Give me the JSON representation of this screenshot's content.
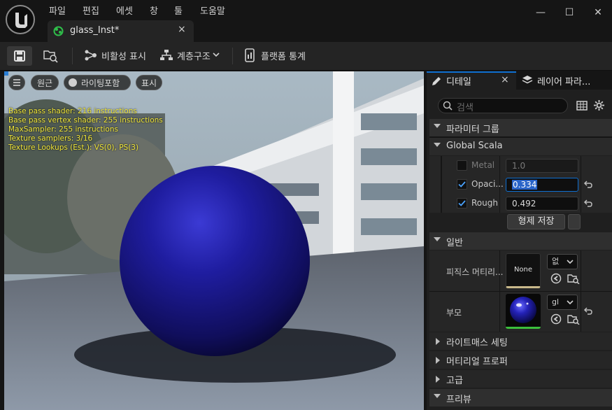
{
  "menu": [
    "파일",
    "편집",
    "에셋",
    "창",
    "툴",
    "도움말"
  ],
  "window_controls": {
    "minimize": "—",
    "maximize": "☐",
    "close": "✕"
  },
  "document_tab": {
    "label": "glass_Inst*",
    "close": "×"
  },
  "toolbar": {
    "visibility_label": "비활성 표시",
    "hierarchy_label": "계층구조",
    "platform_stats_label": "플랫폼 통계"
  },
  "viewport": {
    "perspective_label": "원근",
    "lighting_label": "라이팅포함",
    "show_label": "표시",
    "stats": [
      "Base pass shader: 216 instructions",
      "Base pass vertex shader: 255 instructions",
      "MaxSampler: 255 instructions",
      "Texture samplers: 3/16",
      "Texture Lookups (Est.): VS(0), PS(3)"
    ]
  },
  "details": {
    "tab_details": "디테일",
    "tab_close": "×",
    "tab_layers": "레이어 파라...",
    "search_placeholder": "검색",
    "section_param_groups": "파라미터 그룹",
    "section_global_scalar": "Global Scala",
    "params": [
      {
        "label": "Metal",
        "value": "1.0",
        "checked": false
      },
      {
        "label": "Opaci...",
        "value": "0.334",
        "checked": true
      },
      {
        "label": "Rough",
        "value": "0.492",
        "checked": true
      }
    ],
    "save_sibling_button": "형제 저장",
    "section_general": "일반",
    "phys_material_label": "피직스 머티리...",
    "phys_material_thumb": "None",
    "phys_material_dropdown": "없",
    "parent_label": "부모",
    "parent_dropdown": "gl",
    "section_lightmass": "라이트매스 세팅",
    "section_material_props": "머티리얼 프로퍼",
    "section_advanced": "고급",
    "section_preview": "프리뷰"
  },
  "colors": {
    "accent": "#0e6fd1",
    "sphere": "#1c1a8a",
    "stat_text": "#f0e63a",
    "thumb_underline_none": "#c8b88a",
    "thumb_underline_parent": "#3bbf3b"
  }
}
